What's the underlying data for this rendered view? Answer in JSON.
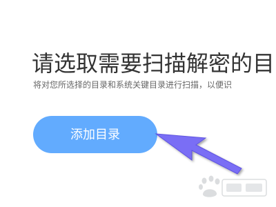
{
  "page": {
    "title": "请选取需要扫描解密的目",
    "description": "将对您所选择的目录和系统关键目录进行扫描，以便识"
  },
  "actions": {
    "add_directory_label": "添加目录"
  },
  "colors": {
    "button_bg": "#62abfe",
    "button_text": "#ffffff",
    "arrow_fill": "#7a6ef5",
    "title_text": "#333333"
  },
  "overlay": {
    "arrow_icon": "pointer-arrow-icon",
    "watermark_icon": "baidu-jingyan-watermark-icon"
  }
}
